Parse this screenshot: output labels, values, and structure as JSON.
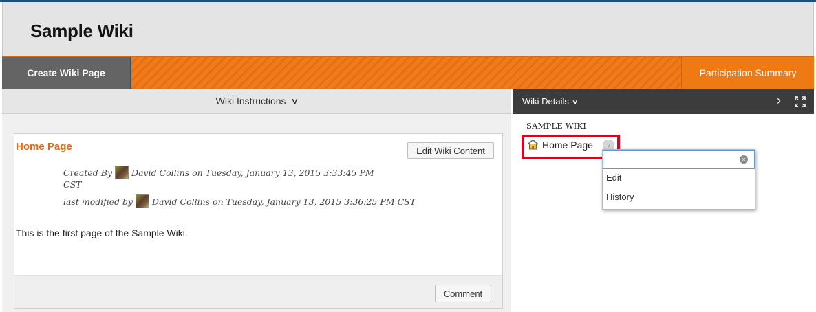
{
  "header": {
    "title": "Sample Wiki"
  },
  "actionbar": {
    "create_label": "Create Wiki Page",
    "participation_label": "Participation Summary"
  },
  "instructions": {
    "label": "Wiki Instructions"
  },
  "page": {
    "title": "Home Page",
    "edit_button": "Edit Wiki Content",
    "created_line1": "Created By",
    "created_line1_rest": "David Collins on Tuesday, January 13, 2015 3:33:45 PM",
    "created_line2": "CST",
    "modified_prefix": "last modified by",
    "modified_rest": "David Collins on Tuesday, January 13, 2015 3:36:25 PM CST",
    "body": "This is the first page of the Sample Wiki.",
    "comment_button": "Comment"
  },
  "details": {
    "label": "Wiki Details",
    "wiki_name": "SAMPLE WIKI",
    "home_item": "Home Page"
  },
  "context_menu": {
    "search_value": "",
    "items": [
      "Edit",
      "History"
    ]
  },
  "icons": {
    "chevron": "chevron-down-icon",
    "next": "chevron-right-icon",
    "expand": "expand-icon",
    "home": "home-icon",
    "clear": "clear-icon"
  },
  "colors": {
    "accent_orange": "#ef7a14",
    "title_orange": "#e06a15",
    "dark_bar": "#3c3c3c",
    "highlight_red": "#e0001b"
  }
}
